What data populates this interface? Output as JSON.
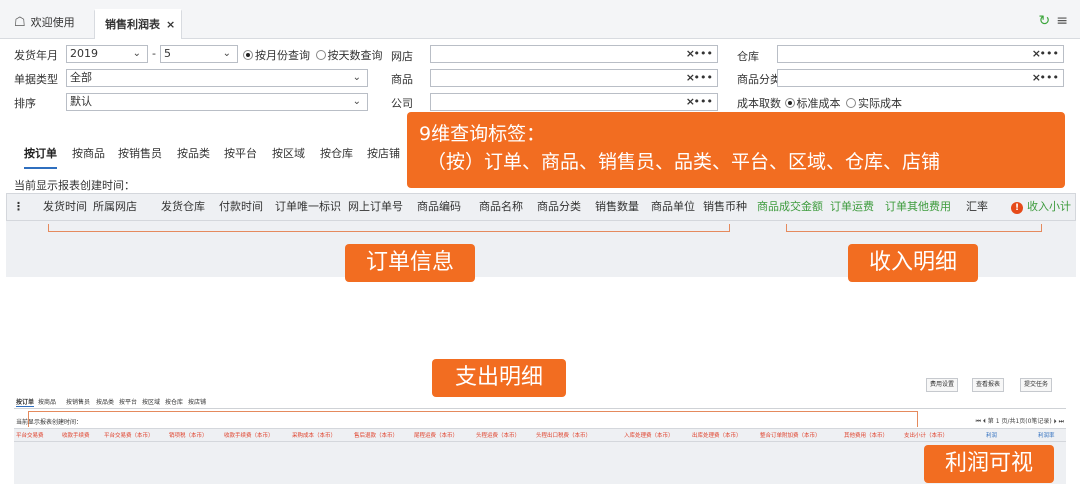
{
  "tabs": {
    "home": "欢迎使用",
    "active": "销售利润表",
    "close": "×"
  },
  "filters": {
    "ship_month_label": "发货年月",
    "year": "2019",
    "dash": "-",
    "month": "5",
    "by_month": "按月份查询",
    "by_days": "按天数查询",
    "doc_type_label": "单据类型",
    "doc_type_value": "全部",
    "sort_label": "排序",
    "sort_value": "默认",
    "store_label": "网店",
    "product_label": "商品",
    "company_label": "公司",
    "warehouse_label": "仓库",
    "category_label": "商品分类",
    "cost_label": "成本取数",
    "std_cost": "标准成本",
    "actual_cost": "实际成本",
    "clear": "×",
    "more": "•••"
  },
  "dim_tabs": [
    "按订单",
    "按商品",
    "按销售员",
    "按品类",
    "按平台",
    "按区域",
    "按仓库",
    "按店铺"
  ],
  "callouts": {
    "dims_line1": "9维查询标签：",
    "dims_line2": "（按）订单、商品、销售员、品类、平台、区域、仓库、店铺",
    "order_info": "订单信息",
    "income": "收入明细",
    "expense": "支出明细",
    "profit": "利润可视"
  },
  "created_text": "当前显示报表创建时间：",
  "columns": {
    "order": [
      "发货时间",
      "所属网店",
      "发货仓库",
      "付款时间",
      "订单唯一标识",
      "网上订单号",
      "商品编码",
      "商品名称",
      "商品分类",
      "销售数量",
      "商品单位",
      "销售币种"
    ],
    "income": [
      "商品成交金额",
      "订单运费",
      "订单其他费用"
    ],
    "rate": "汇率",
    "income_subtotal": "收入小计"
  },
  "mini": {
    "buttons": [
      "费用设置",
      "查看报表",
      "提交任务"
    ],
    "tabs": [
      "按订单",
      "按商品",
      "按销售员",
      "按品类",
      "按平台",
      "按区域",
      "按仓库",
      "按店铺"
    ],
    "created": "当前显示报表创建时间：",
    "pager": "⏮ ⏴ 第 1 页/共1页(0笔记录) ⏵ ⏭",
    "expense_cols": [
      "平台交易费",
      "收款手续费",
      "平台交易费（本币）",
      "销项税（本币）",
      "收款手续费（本币）",
      "采购成本（本币）",
      "售后退款（本币）",
      "尾程运费（本币）",
      "头程运费（本币）",
      "头程出口税费（本币）",
      "入库处理费（本币）",
      "出库处理费（本币）",
      "整合订单附加费（本币）",
      "其他费用（本币）",
      "支出小计（本币）"
    ],
    "profit_cols": [
      "利润",
      "利润率"
    ]
  }
}
